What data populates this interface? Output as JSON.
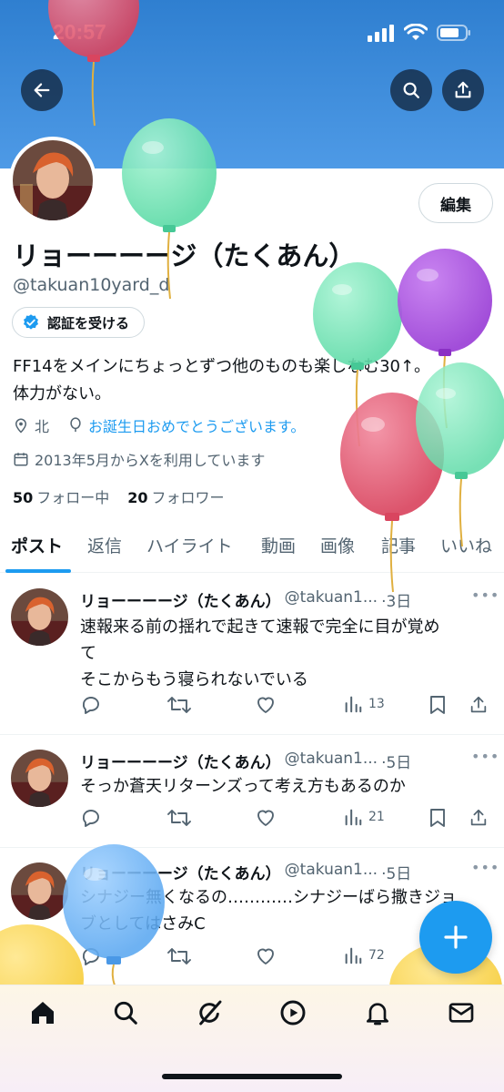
{
  "status_bar": {
    "time": "20:57"
  },
  "profile": {
    "edit_label": "編集",
    "name": "リョーーーージ（たくあん）",
    "handle": "@takuan10yard_d",
    "verify_label": "認証を受ける",
    "bio_line1": "FF14をメインにちょっとずつ他のものも楽しなむ30↑。",
    "bio_line2": "体力がない。",
    "location": "北",
    "birthday_text": "お誕生日おめでとうございます。",
    "joined": "2013年5月からXを利用しています",
    "following_count": "50",
    "following_label": "フォロー中",
    "followers_count": "20",
    "followers_label": "フォロワー"
  },
  "tabs": [
    "ポスト",
    "返信",
    "ハイライト",
    "動画",
    "画像",
    "記事",
    "いいね"
  ],
  "posts": [
    {
      "name": "リョーーーージ（たくあん）",
      "handle": "@takuan1...",
      "time": "·3日",
      "line1": "速報来る前の揺れで起きて速報で完全に目が覚め",
      "line2": "て",
      "line3": "そこからもう寝られないでいる",
      "views": "13"
    },
    {
      "name": "リョーーーージ（たくあん）",
      "handle": "@takuan1...",
      "time": "·5日",
      "line1": "そっか蒼天リターンズって考え方もあるのか",
      "views": "21"
    },
    {
      "name": "リョーーーージ（たくあん）",
      "handle": "@takuan1...",
      "time": "·5日",
      "line1": "シナジー無くなるの…………シナジーばら撒きジョ",
      "line2": "ブとしてはさみC",
      "views": "72"
    }
  ],
  "colors": {
    "accent": "#1d9bf0",
    "banner": "#3a8ad8",
    "text": "#0f1419",
    "muted": "#536471"
  },
  "icons": [
    "back-arrow-icon",
    "search-icon",
    "share-icon",
    "verified-badge-icon",
    "location-pin-icon",
    "balloon-icon",
    "calendar-icon",
    "reply-icon",
    "retweet-icon",
    "like-icon",
    "views-icon",
    "bookmark-icon",
    "home-icon",
    "grok-icon",
    "video-icon",
    "bell-icon",
    "mail-icon",
    "compose-plus-icon"
  ]
}
